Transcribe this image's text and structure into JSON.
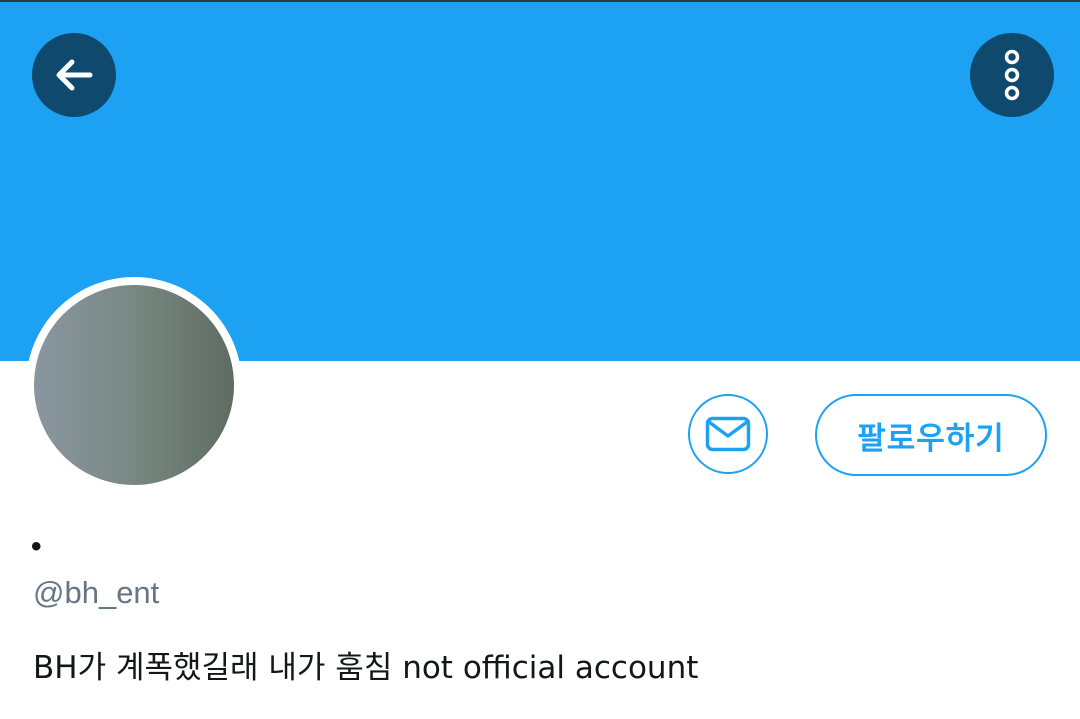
{
  "header": {
    "back_icon": "arrow-left-icon",
    "more_icon": "more-vertical-icon",
    "banner_color": "#1da1f2",
    "button_color": "#0f4a6e"
  },
  "profile": {
    "display_name": "•",
    "handle": "@bh_ent",
    "bio": "BH가 계폭했길래 내가 훔침 not official account"
  },
  "actions": {
    "message_icon": "envelope-icon",
    "follow_label": "팔로우하기",
    "accent_color": "#1da1f2"
  }
}
